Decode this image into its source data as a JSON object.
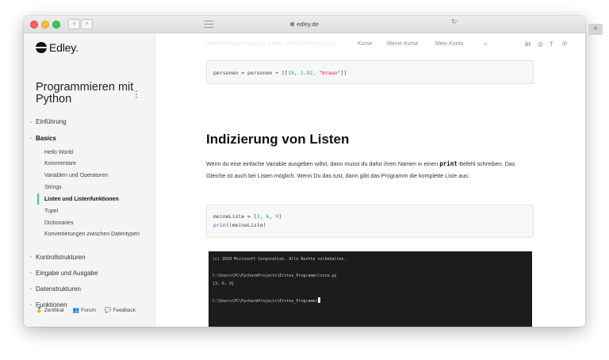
{
  "browser": {
    "url": "edley.de",
    "back_glyph": "‹",
    "forward_glyph": "›",
    "reload_glyph": "↻",
    "new_tab_glyph": "+"
  },
  "brand": {
    "name": "Edley.",
    "accent": "#3ec3a0"
  },
  "top_nav": {
    "ghost_text": "Listenfunktionen gezeigt. Listen und Listenfunktionen",
    "links": [
      "Kurse",
      "Meine Kurse",
      "Mein Konto"
    ],
    "icons": {
      "search": "⌕",
      "linkedin": "in",
      "instagram": "◎",
      "facebook": "f",
      "pinterest": "℗"
    }
  },
  "sidebar": {
    "course_title": "Programmieren mit Python",
    "sections": [
      {
        "label": "Einführung"
      },
      {
        "label": "Basics",
        "expanded": true,
        "items": [
          {
            "label": "Hello World"
          },
          {
            "label": "Kommentare"
          },
          {
            "label": "Variablen und Operatoren"
          },
          {
            "label": "Strings"
          },
          {
            "label": "Listen und Listenfunktionen",
            "active": true
          },
          {
            "label": "Tupel"
          },
          {
            "label": "Dictionaries"
          },
          {
            "label": "Konvertierungen zwischen Datentypen"
          }
        ]
      },
      {
        "label": "Kontrollstrukturen"
      },
      {
        "label": "Eingabe und Ausgabe"
      },
      {
        "label": "Datenstrukturen"
      },
      {
        "label": "Funktionen"
      }
    ],
    "footer": {
      "zertifikat": "Zertifikat",
      "forum": "Forum",
      "feedback": "Feedback"
    }
  },
  "main": {
    "code1": {
      "var": "personen",
      "op": " = personen + [[",
      "n1": "19",
      "sep1": ", ",
      "n2": "1.92",
      "sep2": ", ",
      "s": "\"braun\"",
      "end": "]]"
    },
    "heading": "Indizierung von Listen",
    "para": {
      "a": "Wenn du eine einfache Variable ausgeben willst, dann musst du dafür ihren Namen in einen ",
      "code": "print",
      "b": "-Befehl schreiben. Das Gleiche ist auch bei Listen möglich. Wenn Du das tust, dann gibt das Programm die komplette Liste aus:"
    },
    "code2": {
      "line1_pre": "meineListe = [",
      "n1": "3",
      "sep1": ", ",
      "n2": "6",
      "sep2": ", ",
      "n3": "9",
      "line1_post": "]",
      "line2_fn": "print",
      "line2_rest": "(meineListe)"
    },
    "terminal": {
      "lines": [
        "(c) 2018 Microsoft Corporation. Alle Rechte vorbehalten.",
        "C:\\Users\\PC\\PycharmProjects\\Erstes_Programm>liste.py",
        "[3, 6, 9]",
        "C:\\Users\\PC\\PycharmProjects\\Erstes_Programm>"
      ]
    }
  }
}
